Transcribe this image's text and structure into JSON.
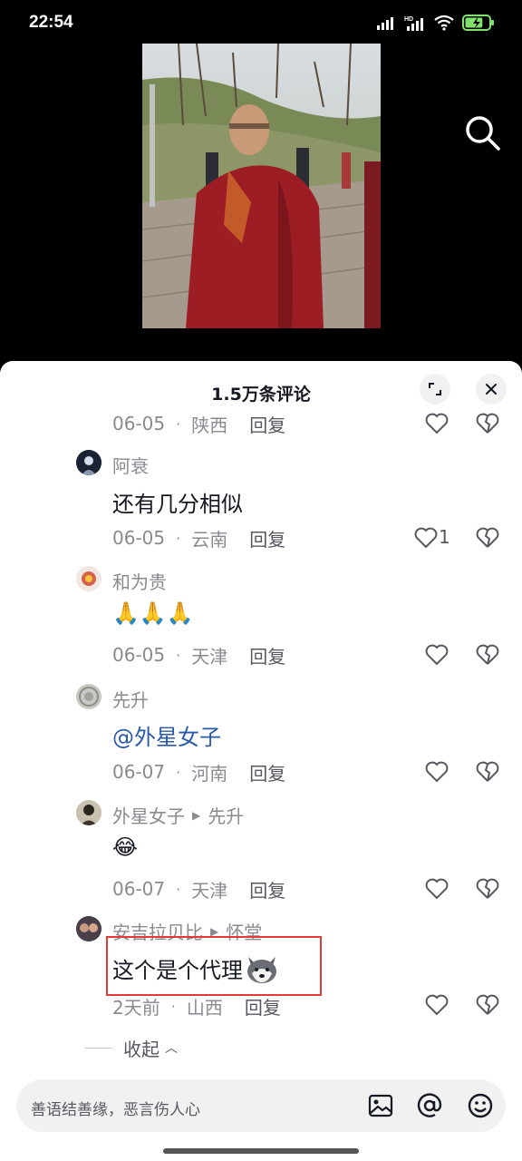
{
  "status_bar": {
    "time": "22:54",
    "battery_level": 0.75
  },
  "sheet": {
    "title": "1.5万条评论"
  },
  "first_meta": {
    "date": "06-05",
    "location": "陕西",
    "reply": "回复"
  },
  "comments": [
    {
      "user": "阿衰",
      "text": "还有几分相似",
      "date": "06-05",
      "location": "云南",
      "reply": "回复",
      "likes": "1"
    },
    {
      "user": "和为贵",
      "text": "🙏🙏🙏",
      "date": "06-05",
      "location": "天津",
      "reply": "回复"
    },
    {
      "user": "先升",
      "text": "@外星女子",
      "date": "06-07",
      "location": "河南",
      "reply": "回复"
    },
    {
      "user": "外星女子",
      "reply_to": "先升",
      "text": "😂",
      "date": "06-07",
      "location": "天津",
      "reply": "回复"
    },
    {
      "user": "安吉拉贝比",
      "reply_to": "怀堂",
      "text": "这个是个代理",
      "date": "2天前",
      "location": "山西",
      "reply": "回复"
    }
  ],
  "collapse_label": "收起",
  "input": {
    "placeholder": "善语结善缘，恶言伤人心"
  },
  "colors": {
    "accent_mention": "#2a5aa8",
    "highlight": "#e53935"
  }
}
